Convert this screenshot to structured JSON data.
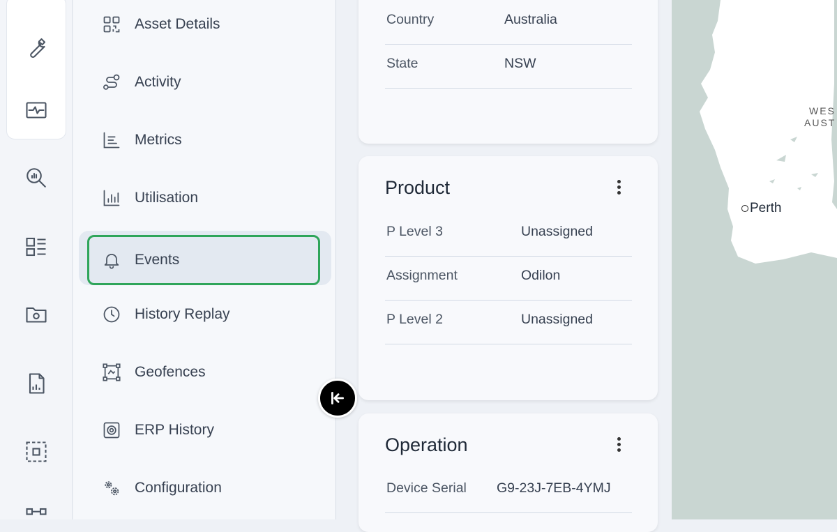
{
  "rail": {
    "icons": [
      "wrench-icon",
      "activity-monitor-icon",
      "search-analytics-icon",
      "dashboard-icon",
      "folder-settings-icon",
      "report-icon",
      "selection-icon",
      "connection-icon"
    ]
  },
  "nav": {
    "items": [
      {
        "label": "Asset Details",
        "icon": "qr-code-icon"
      },
      {
        "label": "Activity",
        "icon": "route-icon"
      },
      {
        "label": "Metrics",
        "icon": "list-chart-icon"
      },
      {
        "label": "Utilisation",
        "icon": "bar-chart-icon"
      },
      {
        "label": "Events",
        "icon": "bell-icon",
        "active": true
      },
      {
        "label": "History Replay",
        "icon": "clock-icon"
      },
      {
        "label": "Geofences",
        "icon": "geofence-icon"
      },
      {
        "label": "ERP History",
        "icon": "erp-icon"
      },
      {
        "label": "Configuration",
        "icon": "gears-icon"
      }
    ]
  },
  "location_card": {
    "rows": [
      {
        "key": "Country",
        "value": "Australia"
      },
      {
        "key": "State",
        "value": "NSW"
      }
    ]
  },
  "product_card": {
    "title": "Product",
    "rows": [
      {
        "key": "P Level 3",
        "value": "Unassigned"
      },
      {
        "key": "Assignment",
        "value": "Odilon"
      },
      {
        "key": "P Level 2",
        "value": "Unassigned"
      }
    ]
  },
  "operation_card": {
    "title": "Operation",
    "rows": [
      {
        "key": "Device Serial",
        "value": "G9-23J-7EB-4YMJ"
      }
    ]
  },
  "map": {
    "region_label_line1": "WES",
    "region_label_line2": "AUST",
    "city": "Perth"
  },
  "colors": {
    "active_border": "#2fa55a",
    "active_bg": "#e3e9f1",
    "map_water": "#c9d6d2",
    "map_land": "#ffffff"
  }
}
